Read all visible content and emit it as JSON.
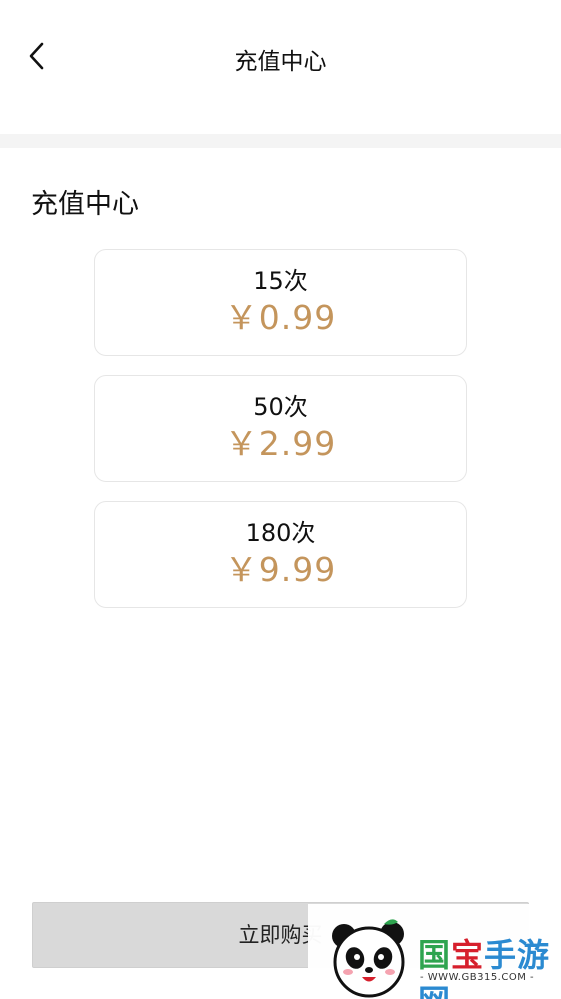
{
  "header": {
    "title": "充值中心"
  },
  "section": {
    "heading": "充值中心"
  },
  "plans": [
    {
      "count": "15次",
      "price": "￥0.99"
    },
    {
      "count": "50次",
      "price": "￥2.99"
    },
    {
      "count": "180次",
      "price": "￥9.99"
    }
  ],
  "footer": {
    "buy_label": "立即购买"
  },
  "watermark": {
    "name_part1": "国",
    "name_part2": "宝",
    "name_part3": "手游网",
    "url": "- WWW.GB315.COM -"
  },
  "colors": {
    "price": "#c4955c",
    "button_bg": "#d9d9d9",
    "divider": "#f4f4f4"
  },
  "icons": {
    "back": "chevron-left-icon",
    "logo": "panda-logo-icon"
  }
}
